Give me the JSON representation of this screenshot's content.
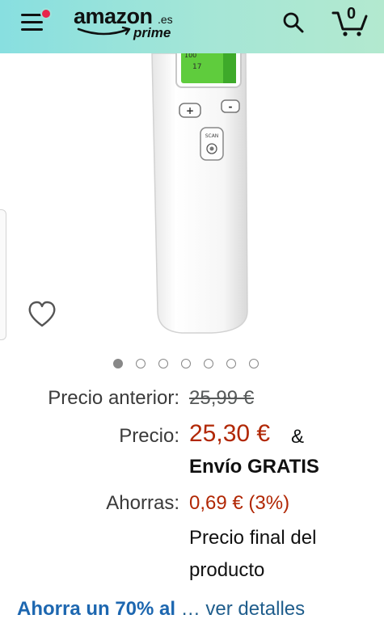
{
  "header": {
    "logo_text": "amazon",
    "logo_suffix": ".es",
    "logo_prime": "prime",
    "cart_count": "0",
    "colors": {
      "gradient_start": "#88dfe0",
      "gradient_end": "#b3e9cf",
      "notification_dot": "#e8244b"
    },
    "icons": [
      "menu-icon",
      "search-icon",
      "cart-icon"
    ]
  },
  "product_image": {
    "device_buttons": [
      "+",
      "-"
    ],
    "scan_label": "SCAN",
    "screen_text": [
      "100",
      "17"
    ]
  },
  "carousel": {
    "count": 7,
    "active_index": 0
  },
  "pricing": {
    "previous_label": "Precio anterior:",
    "previous_value": "25,99 €",
    "price_label": "Precio:",
    "price_value": "25,30 €",
    "price_amp": "&",
    "shipping": "Envío GRATIS",
    "savings_label": "Ahorras:",
    "savings_value": "0,69 € (3%)",
    "final_note_line1": "Precio final del",
    "final_note_line2": "producto"
  },
  "deal": {
    "bold_text": "Ahorra un 70% al",
    "link_text": "… ver detalles"
  },
  "colors": {
    "price_red": "#b12704",
    "link_blue": "#1d67b0"
  }
}
